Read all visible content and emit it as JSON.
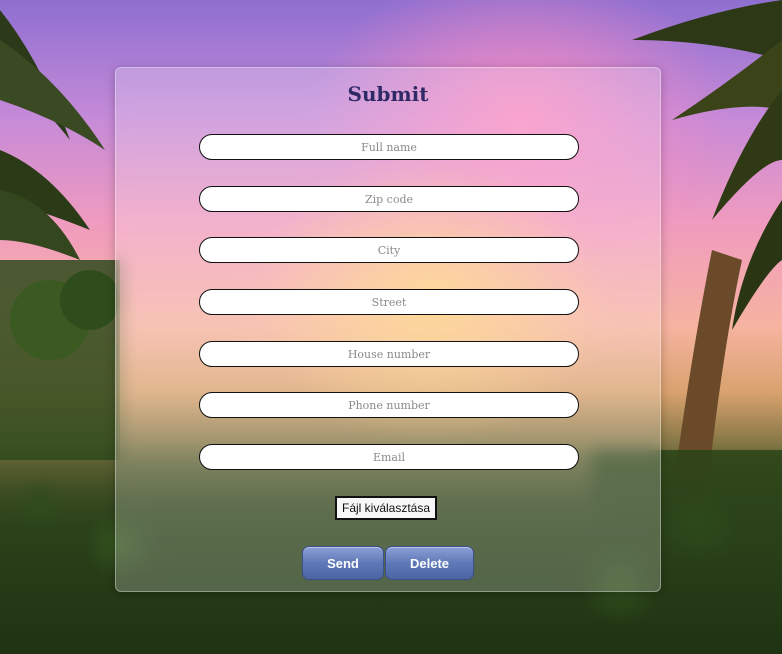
{
  "form": {
    "title": "Submit",
    "fields": [
      {
        "placeholder": "Full name"
      },
      {
        "placeholder": "Zip code"
      },
      {
        "placeholder": "City"
      },
      {
        "placeholder": "Street"
      },
      {
        "placeholder": "House number"
      },
      {
        "placeholder": "Phone number"
      },
      {
        "placeholder": "Email"
      }
    ],
    "file_button_label": "Fájl kiválasztása",
    "send_label": "Send",
    "delete_label": "Delete"
  }
}
